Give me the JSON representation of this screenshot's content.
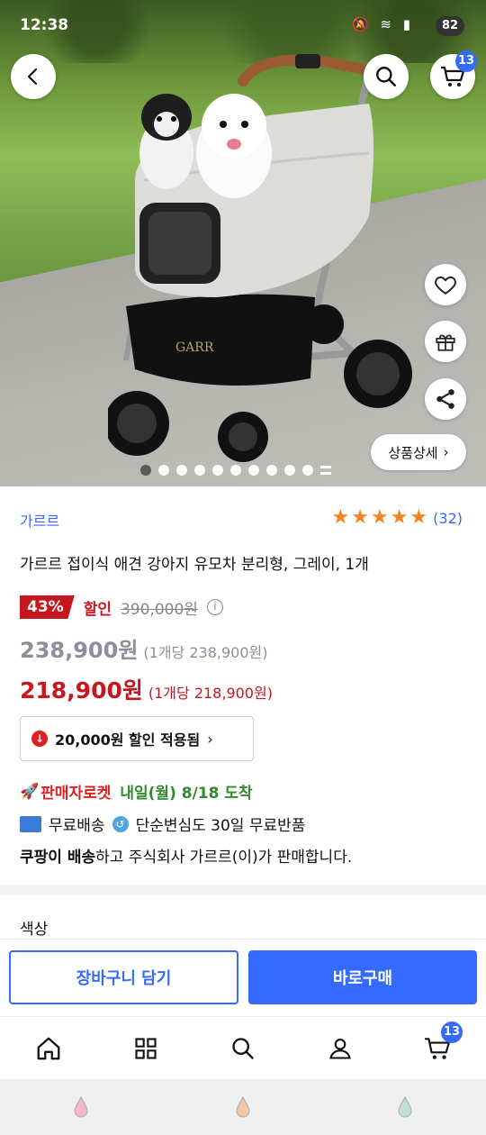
{
  "status_bar": {
    "time": "12:38",
    "battery": "82"
  },
  "header": {
    "cart_count": "13"
  },
  "gallery": {
    "detail_button_label": "상품상세",
    "dots": [
      true,
      false,
      false,
      false,
      false,
      false,
      false,
      false,
      false,
      false
    ],
    "brand_on_bag": "GARR"
  },
  "product": {
    "brand": "가르르",
    "rating_count": "(32)",
    "title": "가르르 접이식 애견 강아지 유모차 분리형, 그레이, 1개",
    "discount_percent": "43%",
    "discount_label": "할인",
    "original_price": "390,000원",
    "sale_price": "238,900원",
    "sale_unit_price": "(1개당 238,900원)",
    "final_price": "218,900원",
    "final_unit_price": "(1개당 218,900원)",
    "coupon_text": "20,000원 할인 적용됨"
  },
  "delivery": {
    "rocket_label": "판매자로켓",
    "arrival": "내일(월) 8/18 도착",
    "free_shipping": "무료배송",
    "free_return": "단순변심도 30일 무료반품",
    "seller_bold": "쿠팡이 배송",
    "seller_rest": "하고 주식회사 가르르(이)가 판매합니다."
  },
  "options": {
    "color_label": "색상"
  },
  "actions": {
    "add_to_cart": "장바구니 담기",
    "buy_now": "바로구매"
  },
  "tabbar": {
    "cart_count": "13"
  },
  "colors": {
    "accent": "#346aff",
    "sale": "#c8161e",
    "star": "#f58220",
    "rocket_date": "#2e8b2e"
  }
}
